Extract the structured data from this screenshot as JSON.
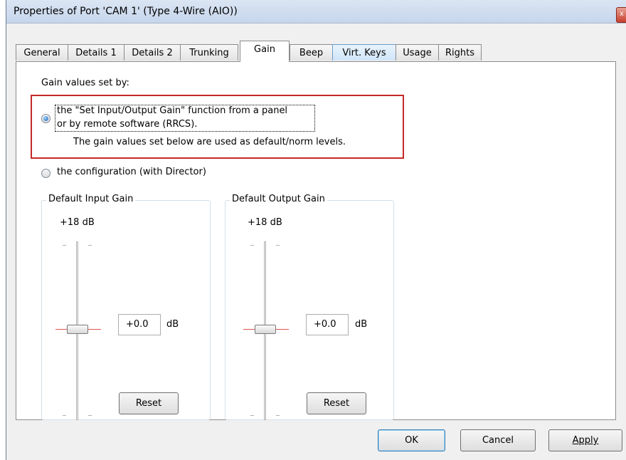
{
  "window": {
    "title": "Properties of Port 'CAM 1' (Type 4-Wire (AIO))",
    "close_glyph": "x"
  },
  "tabs": [
    {
      "label": "General"
    },
    {
      "label": "Details 1"
    },
    {
      "label": "Details 2"
    },
    {
      "label": "Trunking"
    },
    {
      "label": "Gain",
      "active": true
    },
    {
      "label": "Beep"
    },
    {
      "label": "Virt. Keys"
    },
    {
      "label": "Usage"
    },
    {
      "label": "Rights"
    }
  ],
  "gain": {
    "section_label": "Gain values set by:",
    "option1_line1": "the \"Set Input/Output Gain\" function from a panel",
    "option1_line2": "or by remote software (RRCS).",
    "option1_note": "The gain values set below are used as default/norm levels.",
    "option1_selected": true,
    "option2_label": "the configuration (with Director)",
    "option2_selected": false
  },
  "input_gain": {
    "group_label": "Default Input Gain",
    "max_label": "+18 dB",
    "value": "+0.0",
    "unit": "dB",
    "reset_label": "Reset"
  },
  "output_gain": {
    "group_label": "Default Output Gain",
    "max_label": "+18 dB",
    "value": "+0.0",
    "unit": "dB",
    "reset_label": "Reset"
  },
  "buttons": {
    "ok": "OK",
    "cancel": "Cancel",
    "apply": "Apply"
  },
  "colors": {
    "highlight_border": "#c62828",
    "slider_zero_line": "#d9534f"
  }
}
